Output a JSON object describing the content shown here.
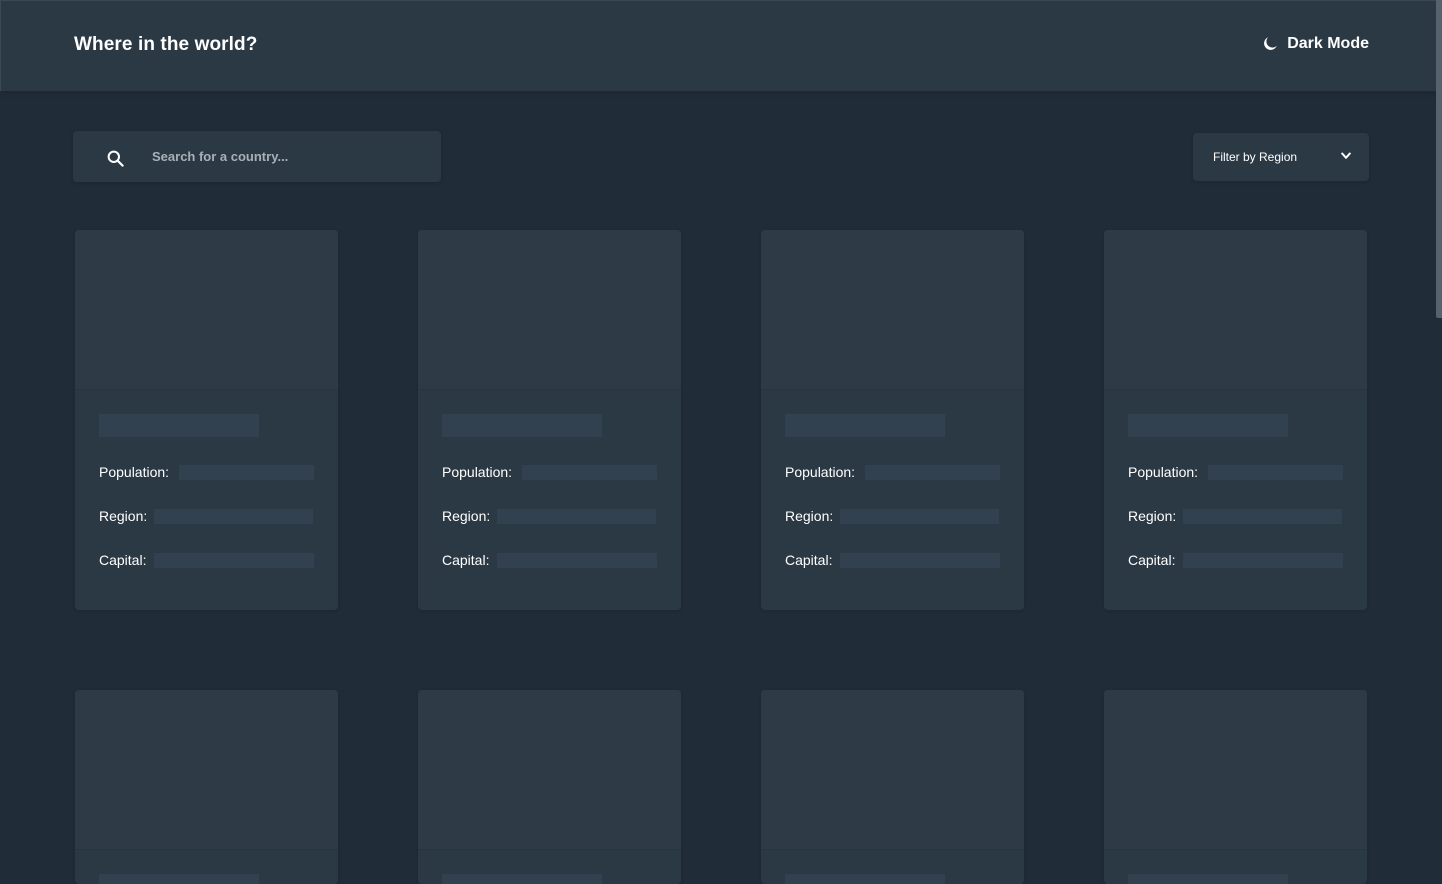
{
  "header": {
    "title": "Where in the world?",
    "dark_mode_label": "Dark Mode",
    "dark_mode_icon": "moon-icon"
  },
  "search": {
    "placeholder": "Search for a country...",
    "value": "",
    "icon": "search-icon"
  },
  "filter": {
    "label": "Filter by Region",
    "icon": "chevron-down-icon"
  },
  "card_fields": {
    "population_label": "Population:",
    "region_label": "Region:",
    "capital_label": "Capital:"
  },
  "colors": {
    "background": "#202c37",
    "elements": "#2b3945",
    "text": "#ffffff",
    "placeholder_text": "#a8b0b7"
  }
}
